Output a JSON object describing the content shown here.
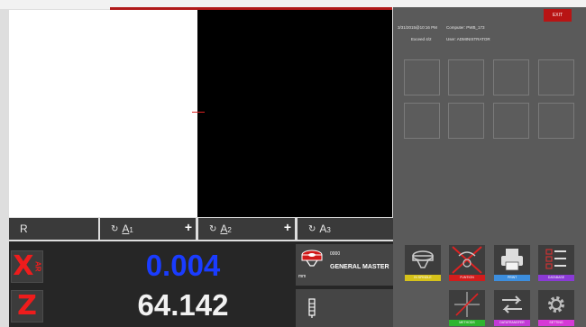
{
  "header": {
    "datetime": "3/31/2015@10:16 PM",
    "computer_label": "Computer: PWB_173",
    "exceed": "Exceed 4/2",
    "user_label": "User: ADMINISTRATOR",
    "exit_label": "EXIT"
  },
  "tabs": {
    "r_label": "R",
    "a1_letter": "A",
    "a1_index": "1",
    "a2_letter": "A",
    "a2_index": "2",
    "a3_letter": "A",
    "a3_index": "3",
    "cycle_glyph": "↻",
    "plus_glyph": "+"
  },
  "dro": {
    "x_axis_letter": "X",
    "x_axis_sub": "AR",
    "x_value": "0.004",
    "z_axis_letter": "Z",
    "z_value": "64.142",
    "x_value_color": "#1a3cff",
    "z_value_color": "#f2f2f2"
  },
  "master": {
    "code": "0000",
    "name": "GENERAL MASTER",
    "unit": "mm"
  },
  "toolbar": {
    "spindle": "IN SPINDLE",
    "function": "FUNTION",
    "print": "PRINT",
    "database": "DATABASE",
    "methods": "METHODS",
    "datatransfer": "DATATRANSFER",
    "setting": "SETTING"
  },
  "colors": {
    "accent_red": "#b81414",
    "spindle_bar": "#d6c21a",
    "function_bar": "#d21c1c",
    "print_bar": "#3c8ede",
    "database_bar": "#8a3ad6",
    "methods_bar": "#2fb52f",
    "datatransfer_bar": "#c23ad6",
    "setting_bar": "#d63ad6"
  }
}
